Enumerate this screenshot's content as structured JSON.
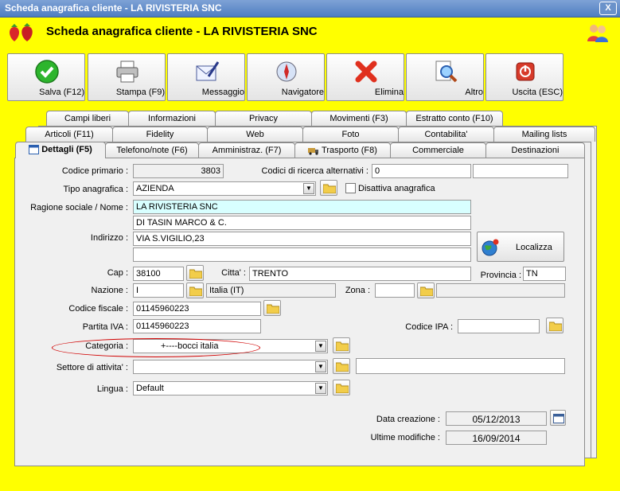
{
  "window": {
    "title": "Scheda anagrafica cliente - LA RIVISTERIA SNC",
    "close_label": "X"
  },
  "header": {
    "title": "Scheda anagrafica cliente - LA RIVISTERIA SNC"
  },
  "toolbar": [
    {
      "label": "Salva (F12)",
      "icon": "check-icon"
    },
    {
      "label": "Stampa (F9)",
      "icon": "printer-icon"
    },
    {
      "label": "Messaggio",
      "icon": "envelope-icon"
    },
    {
      "label": "Navigatore",
      "icon": "compass-icon"
    },
    {
      "label": "Elimina",
      "icon": "x-icon"
    },
    {
      "label": "Altro",
      "icon": "magnifier-icon"
    },
    {
      "label": "Uscita (ESC)",
      "icon": "exit-icon"
    }
  ],
  "tabs": {
    "row1": [
      "Campi liberi",
      "Informazioni",
      "Privacy",
      "Movimenti (F3)",
      "Estratto conto (F10)"
    ],
    "row2": [
      "Articoli (F11)",
      "Fidelity",
      "Web",
      "Foto",
      "Contabilita'",
      "Mailing lists"
    ],
    "row3": [
      "Dettagli (F5)",
      "Telefono/note (F6)",
      "Amministraz. (F7)",
      "Trasporto (F8)",
      "Commerciale",
      "Destinazioni"
    ]
  },
  "form": {
    "codice_primario_label": "Codice primario :",
    "codice_primario": "3803",
    "codici_ricerca_label": "Codici di ricerca alternativi :",
    "codici_ricerca_1": "0",
    "codici_ricerca_2": "",
    "tipo_anagrafica_label": "Tipo anagrafica :",
    "tipo_anagrafica": "AZIENDA",
    "disattiva_label": "Disattiva anagrafica",
    "ragione_sociale_label": "Ragione sociale / Nome :",
    "ragione_sociale_1": "LA RIVISTERIA SNC",
    "ragione_sociale_2": "DI TASIN MARCO & C.",
    "indirizzo_label": "Indirizzo :",
    "indirizzo_1": "VIA S.VIGILIO,23",
    "indirizzo_2": "",
    "localizza_label": "Localizza",
    "cap_label": "Cap :",
    "cap": "38100",
    "citta_label": "Citta' :",
    "citta": "TRENTO",
    "provincia_label": "Provincia :",
    "provincia": "TN",
    "nazione_label": "Nazione :",
    "nazione": "I",
    "nazione_desc": "Italia (IT)",
    "zona_label": "Zona :",
    "zona": "",
    "zona_desc": "",
    "codice_fiscale_label": "Codice fiscale :",
    "codice_fiscale": "01145960223",
    "partita_iva_label": "Partita IVA :",
    "partita_iva": "01145960223",
    "codice_ipa_label": "Codice IPA :",
    "codice_ipa": "",
    "categoria_label": "Categoria :",
    "categoria": "+----bocci italia",
    "settore_label": "Settore di attivita' :",
    "settore": "",
    "settore_desc": "",
    "lingua_label": "Lingua :",
    "lingua": "Default",
    "data_creazione_label": "Data creazione :",
    "data_creazione": "05/12/2013",
    "ultime_modifiche_label": "Ultime modifiche :",
    "ultime_modifiche": "16/09/2014"
  }
}
